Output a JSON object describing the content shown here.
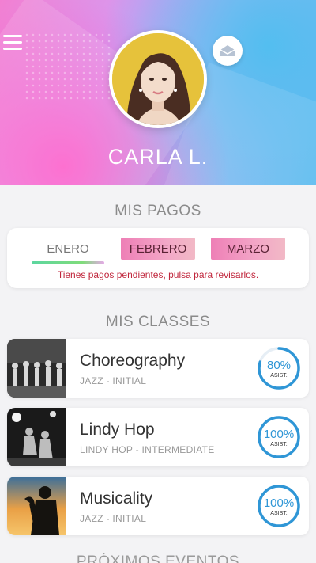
{
  "profile": {
    "name": "CARLA L."
  },
  "payments": {
    "title": "MIS PAGOS",
    "months": [
      {
        "label": "ENERO",
        "status": "paid"
      },
      {
        "label": "FEBRERO",
        "status": "pending"
      },
      {
        "label": "MARZO",
        "status": "pending"
      }
    ],
    "pending_message": "Tienes pagos pendientes, pulsa para revisarlos."
  },
  "classes": {
    "title": "MIS CLASSES",
    "items": [
      {
        "name": "Choreography",
        "subtitle": "JAZZ - INITIAL",
        "attendance": "80%",
        "attendance_value": 0.8,
        "attendance_label": "ASIST."
      },
      {
        "name": "Lindy Hop",
        "subtitle": "LINDY HOP - INTERMEDIATE",
        "attendance": "100%",
        "attendance_value": 1.0,
        "attendance_label": "ASIST."
      },
      {
        "name": "Musicality",
        "subtitle": "JAZZ - INITIAL",
        "attendance": "100%",
        "attendance_value": 1.0,
        "attendance_label": "ASIST."
      }
    ]
  },
  "events": {
    "title": "PRÓXIMOS EVENTOS"
  },
  "icons": {
    "menu": "menu-icon",
    "mail": "mail-icon"
  },
  "colors": {
    "accent": "#2f96d6",
    "pending": "#c0263c"
  }
}
